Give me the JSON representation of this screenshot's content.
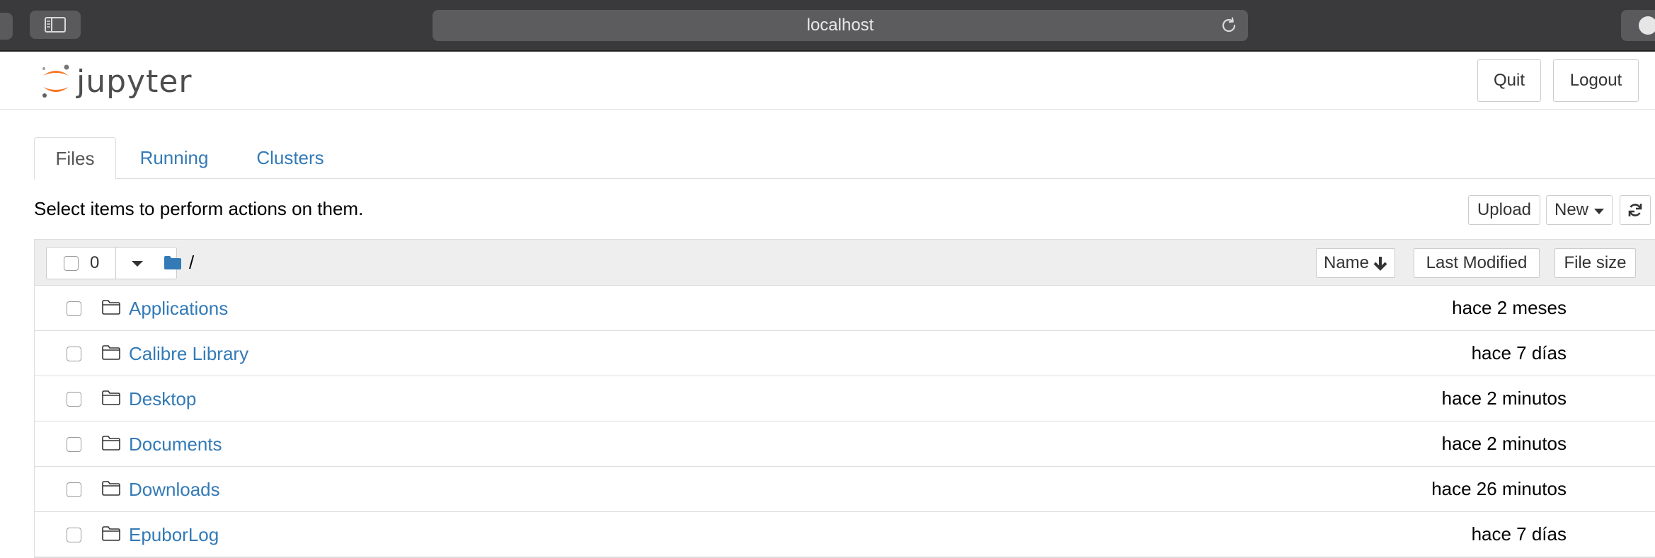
{
  "browser": {
    "url": "localhost"
  },
  "header": {
    "logo_text": "jupyter",
    "quit_label": "Quit",
    "logout_label": "Logout"
  },
  "tabs": [
    {
      "label": "Files",
      "active": true
    },
    {
      "label": "Running",
      "active": false
    },
    {
      "label": "Clusters",
      "active": false
    }
  ],
  "toolbar": {
    "instructions": "Select items to perform actions on them.",
    "upload_label": "Upload",
    "new_label": "New"
  },
  "list_header": {
    "selected_count": "0",
    "path": "/",
    "sort_name_label": "Name",
    "sort_modified_label": "Last Modified",
    "sort_size_label": "File size"
  },
  "files": [
    {
      "name": "Applications",
      "modified": "hace 2 meses"
    },
    {
      "name": "Calibre Library",
      "modified": "hace 7 días"
    },
    {
      "name": "Desktop",
      "modified": "hace 2 minutos"
    },
    {
      "name": "Documents",
      "modified": "hace 2 minutos"
    },
    {
      "name": "Downloads",
      "modified": "hace 26 minutos"
    },
    {
      "name": "EpuborLog",
      "modified": "hace 7 días"
    }
  ],
  "colors": {
    "link": "#337ab7",
    "logo_orange": "#f37726",
    "chrome_bg": "#3a3a3c"
  }
}
